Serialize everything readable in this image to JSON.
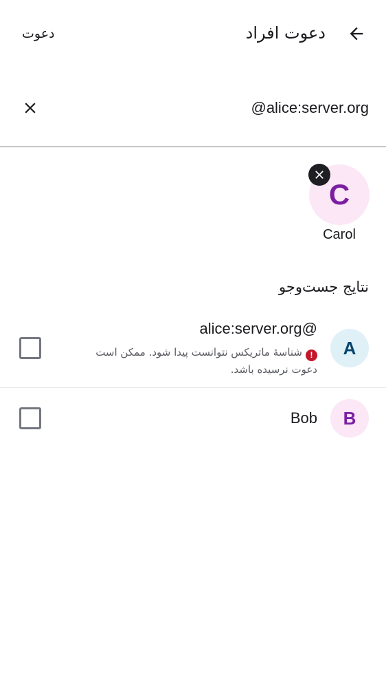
{
  "header": {
    "title": "دعوت افراد",
    "invite_action": "دعوت",
    "back_icon": "arrow-back-icon"
  },
  "search": {
    "value": "alice:server.org@",
    "clear_icon": "close-icon"
  },
  "selected": [
    {
      "initial": "C",
      "name": "Carol",
      "remove_icon": "close-icon",
      "avatar_color": "#fbe7f5",
      "initial_color": "#7b1fa2"
    }
  ],
  "results": {
    "header": "نتایج جست‌وجو",
    "items": [
      {
        "initial": "A",
        "name": "alice:server.org@",
        "warning_icon": "error-icon",
        "warning": "شناسهٔ ماتریکس نتوانست پیدا شود. ممکن است دعوت نرسیده باشد.",
        "checked": false,
        "avatar_color": "#dff0f7",
        "initial_color": "#06466e"
      },
      {
        "initial": "B",
        "name": "Bob",
        "checked": false,
        "avatar_color": "#fbe7f5",
        "initial_color": "#7b1fa2"
      }
    ]
  }
}
